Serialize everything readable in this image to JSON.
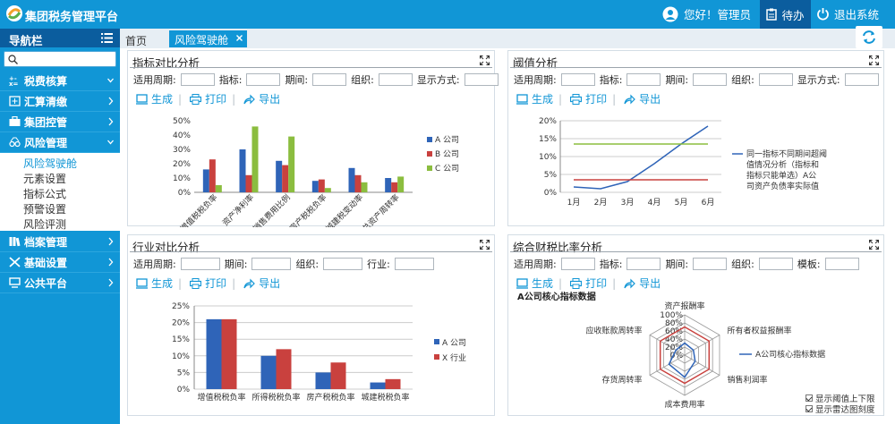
{
  "app": {
    "title": "集团税务管理平台",
    "greeting": "您好！管理员",
    "todo": "待办",
    "logout": "退出系统"
  },
  "colors": {
    "primary": "#1196d6",
    "dark": "#0b5d9e",
    "seriesA": "#2f64b8",
    "seriesB": "#c9413e",
    "seriesC": "#8bbd3f"
  },
  "sidebar": {
    "header": "导航栏",
    "items": [
      {
        "label": "税费核算",
        "icon": "tax-calc-icon"
      },
      {
        "label": "汇算清缴",
        "icon": "settlement-icon"
      },
      {
        "label": "集团控管",
        "icon": "briefcase-icon"
      },
      {
        "label": "风险管理",
        "icon": "risk-icon"
      },
      {
        "label": "档案管理",
        "icon": "archive-icon"
      },
      {
        "label": "基础设置",
        "icon": "tools-icon"
      },
      {
        "label": "公共平台",
        "icon": "monitor-icon"
      }
    ],
    "submenu": [
      "风险驾驶舱",
      "元素设置",
      "指标公式",
      "预警设置",
      "风险评测"
    ]
  },
  "tabs": {
    "home": "首页",
    "active": "风险驾驶舱"
  },
  "actions": {
    "generate": "生成",
    "print": "打印",
    "export": "导出"
  },
  "panels": {
    "p1": {
      "title": "指标对比分析",
      "filters": [
        "适用周期:",
        "指标:",
        "期间:",
        "组织:",
        "显示方式:"
      ]
    },
    "p2": {
      "title": "阈值分析",
      "filters": [
        "适用周期:",
        "指标:",
        "期间:",
        "组织:",
        "显示方式:"
      ]
    },
    "p3": {
      "title": "行业对比分析",
      "filters": [
        "适用周期:",
        "期间:",
        "组织:",
        "行业:"
      ]
    },
    "p4": {
      "title": "综合财税比率分析",
      "filters": [
        "适用周期:",
        "指标:",
        "期间:",
        "组织:",
        "模板:"
      ],
      "checkboxes": [
        "显示阈值上下限",
        "显示雷达图刻度"
      ]
    }
  },
  "chart_data": [
    {
      "type": "bar",
      "title": "",
      "categories": [
        "增值税税负率",
        "资产净利率",
        "销售费用比例",
        "房产税税负率",
        "城建税变动率",
        "总资产周转率"
      ],
      "series": [
        {
          "name": "A 公司",
          "values": [
            16,
            30,
            22,
            8,
            17,
            10
          ]
        },
        {
          "name": "B 公司",
          "values": [
            23,
            12,
            19,
            9,
            12,
            7
          ]
        },
        {
          "name": "C 公司",
          "values": [
            5,
            46,
            39,
            3,
            7,
            11
          ]
        }
      ],
      "yticks": [
        "0%",
        "10%",
        "20%",
        "30%",
        "40%",
        "50%"
      ],
      "ylim": [
        0,
        50
      ],
      "legend": "right"
    },
    {
      "type": "line",
      "categories": [
        "1月",
        "2月",
        "3月",
        "4月",
        "5月",
        "6月"
      ],
      "series": [
        {
          "name": "同一指标不同期间超阈值情况分析（指标和指标只能单选）A公司资产负债率实际值",
          "values": [
            1.5,
            1,
            3,
            8,
            13.5,
            18.5
          ],
          "color": "#2f64b8"
        },
        {
          "values": [
            13.5,
            13.5,
            13.5,
            13.5,
            13.5,
            13.5
          ],
          "color": "#8bbd3f"
        },
        {
          "values": [
            3.5,
            3.5,
            3.5,
            3.5,
            3.5,
            3.5
          ],
          "color": "#c9413e"
        }
      ],
      "yticks": [
        "0%",
        "5%",
        "10%",
        "15%",
        "20%"
      ],
      "ylim": [
        0,
        20
      ],
      "legend": "right"
    },
    {
      "type": "bar",
      "categories": [
        "增值税税负率",
        "所得税税负率",
        "房产税税负率",
        "城建税税负率"
      ],
      "series": [
        {
          "name": "A 公司",
          "values": [
            21,
            10,
            5,
            2
          ]
        },
        {
          "name": "X 行业",
          "values": [
            21,
            12,
            8,
            3
          ]
        }
      ],
      "yticks": [
        "0%",
        "5%",
        "10%",
        "15%",
        "20%",
        "25%"
      ],
      "ylim": [
        0,
        25
      ],
      "legend": "right"
    },
    {
      "type": "radar",
      "title": "A公司核心指标数据",
      "axes": [
        "资产报酬率",
        "所有者权益报酬率",
        "销售利润率",
        "成本费用率",
        "存货周转率",
        "应收账款周转率"
      ],
      "ticks": [
        "0%",
        "20%",
        "40%",
        "60%",
        "80%",
        "100%"
      ],
      "series": [
        {
          "name": "A公司核心指标数据",
          "values": [
            30,
            25,
            30,
            55,
            45,
            25
          ]
        },
        {
          "name": "",
          "values": [
            70,
            70,
            70,
            70,
            70,
            70
          ],
          "color": "#c9413e"
        }
      ],
      "legend": "right"
    }
  ]
}
